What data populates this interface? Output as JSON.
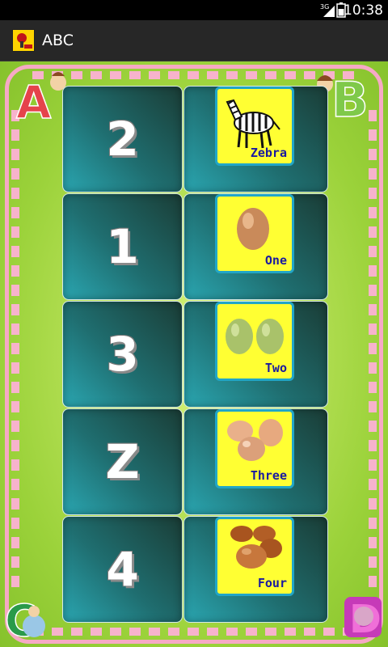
{
  "status_bar": {
    "network": "3G",
    "time": "10:38"
  },
  "action_bar": {
    "title": "ABC"
  },
  "board": {
    "corner_letters": [
      "A",
      "B",
      "C",
      "D"
    ],
    "number_cards": [
      "2",
      "1",
      "3",
      "Z",
      "4"
    ],
    "picture_cards": [
      {
        "caption": "Zebra",
        "icon": "zebra-icon"
      },
      {
        "caption": "One",
        "icon": "one-egg-icon"
      },
      {
        "caption": "Two",
        "icon": "two-eggs-icon"
      },
      {
        "caption": "Three",
        "icon": "three-eggs-icon"
      },
      {
        "caption": "Four",
        "icon": "four-eggs-icon"
      }
    ]
  },
  "colors": {
    "picture_bg": "#ffff33",
    "picture_border": "#21a6c7",
    "caption": "#1a1aa0",
    "frame": "#f6a9c5"
  }
}
